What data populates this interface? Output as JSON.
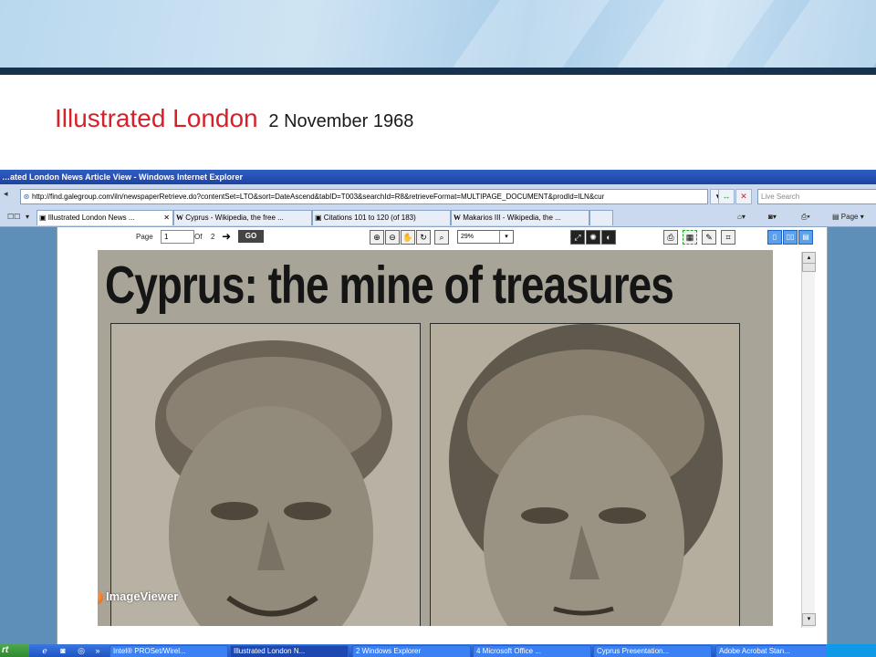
{
  "slide": {
    "title": "Illustrated London",
    "date": "2 November 1968"
  },
  "browser": {
    "window_title": "…ated London News Article View - Windows Internet Explorer",
    "address": "http://find.galegroup.com/iln/newspaperRetrieve.do?contentSet=LTO&sort=DateAscend&tabID=T003&searchId=R8&retrieveFormat=MULTIPAGE_DOCUMENT&prodId=ILN&cur",
    "search_placeholder": "Live Search",
    "tabs": [
      {
        "label": "Illustrated London News ...",
        "icon": "page-icon"
      },
      {
        "label": "Cyprus - Wikipedia, the free ...",
        "icon": "wikipedia-icon"
      },
      {
        "label": "Citations 101 to 120 (of 183)",
        "icon": "page-icon"
      },
      {
        "label": "Makarios III - Wikipedia, the ...",
        "icon": "wikipedia-icon"
      }
    ],
    "page_menu_label": "Page"
  },
  "viewer": {
    "page_label": "Page",
    "page_value": "1",
    "of_label": "Of",
    "total_pages": "2",
    "go_label": "GO",
    "zoom_value": "29%",
    "logo_text": "ImageViewer"
  },
  "article": {
    "headline": "Cyprus: the mine of treasures"
  },
  "taskbar": {
    "start_label": "rt",
    "items": [
      {
        "label": "Intel® PROSet/Wirel...",
        "active": false
      },
      {
        "label": "Illustrated London N...",
        "active": true
      },
      {
        "label": "2 Windows Explorer",
        "active": false
      },
      {
        "label": "4 Microsoft Office ...",
        "active": false
      },
      {
        "label": "Cyprus Presentation...",
        "active": false
      },
      {
        "label": "Adobe Acrobat Stan...",
        "active": false
      }
    ]
  },
  "colors": {
    "title_red": "#d8202a",
    "banner_dark": "#17324f",
    "xp_blue": "#1f54c2"
  }
}
